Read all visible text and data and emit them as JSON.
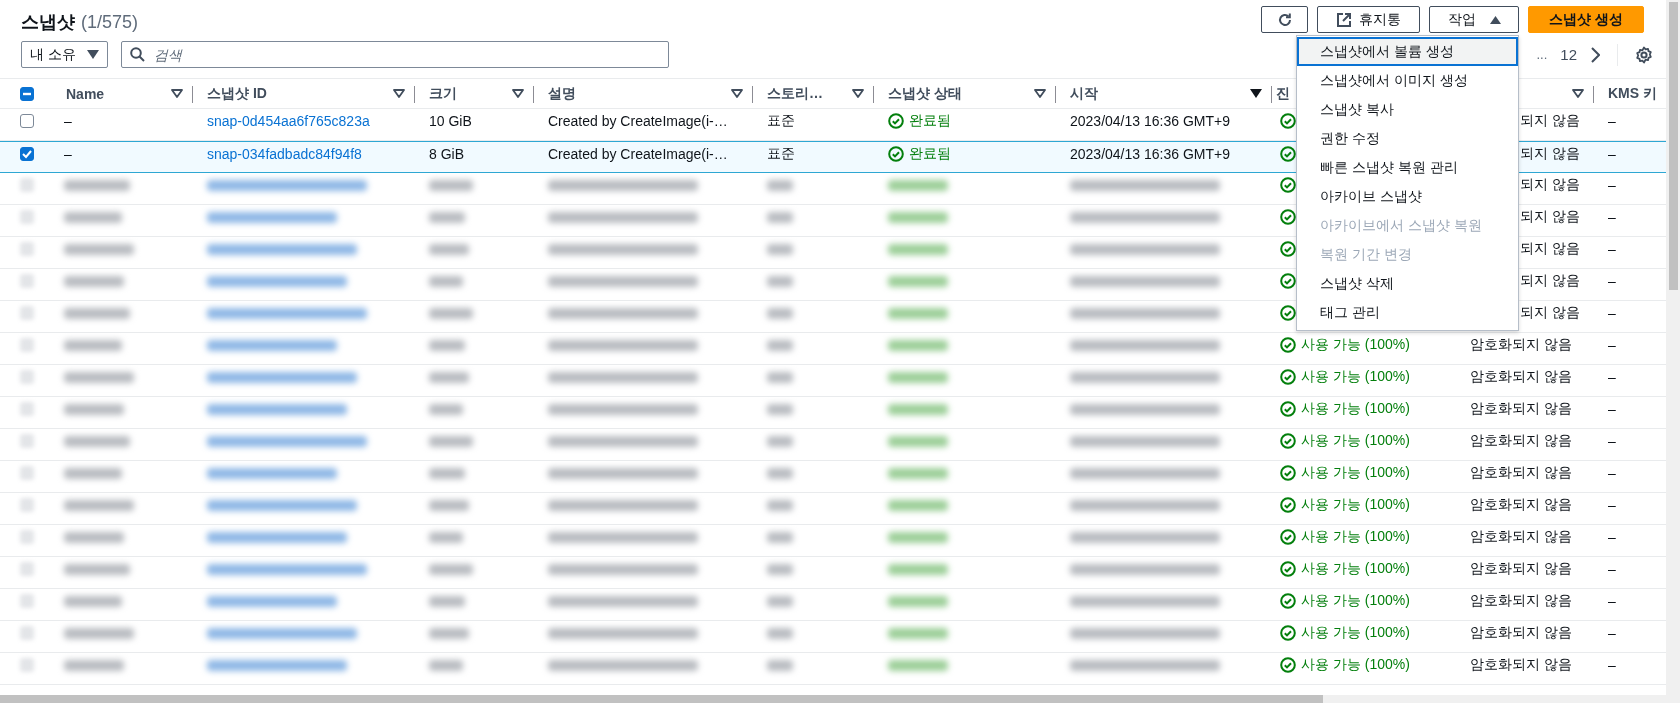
{
  "header": {
    "title": "스냅샷",
    "count": "(1/575)"
  },
  "buttons": [
    {
      "kind": "refresh"
    },
    {
      "kind": "external",
      "label": "휴지통"
    },
    {
      "kind": "dropdown",
      "label": "작업",
      "expanded": true
    },
    {
      "kind": "primary",
      "label": "스냅샷 생성"
    }
  ],
  "actions_menu": [
    {
      "label": "스냅샷에서 볼륨 생성",
      "focused": true,
      "disabled": false
    },
    {
      "label": "스냅샷에서 이미지 생성",
      "focused": false,
      "disabled": false
    },
    {
      "label": "스냅샷 복사",
      "focused": false,
      "disabled": false
    },
    {
      "label": "권한 수정",
      "focused": false,
      "disabled": false
    },
    {
      "label": "빠른 스냅샷 복원 관리",
      "focused": false,
      "disabled": false
    },
    {
      "label": "아카이브 스냅샷",
      "focused": false,
      "disabled": false
    },
    {
      "label": "아카이브에서 스냅샷 복원",
      "focused": false,
      "disabled": true
    },
    {
      "label": "복원 기간 변경",
      "focused": false,
      "disabled": true
    },
    {
      "label": "스냅샷 삭제",
      "focused": false,
      "disabled": false
    },
    {
      "label": "태그 관리",
      "focused": false,
      "disabled": false
    }
  ],
  "filter": {
    "value": "내 소유"
  },
  "search": {
    "placeholder": "검색"
  },
  "pagination": {
    "ellipsis": "...",
    "page": "12"
  },
  "table": {
    "select_all": {
      "indeterminate": true
    },
    "columns": [
      {
        "label": "Name",
        "sorted": false
      },
      {
        "label": "스냅샷 ID",
        "sorted": false
      },
      {
        "label": "크기",
        "sorted": false
      },
      {
        "label": "설명",
        "sorted": false
      },
      {
        "label": "스토리…",
        "sorted": false
      },
      {
        "label": "스냅샷 상태",
        "sorted": false
      },
      {
        "label": "시작",
        "sorted": true
      },
      {
        "label": "진"
      },
      {
        "sorted": false
      },
      {
        "label": "KMS 키"
      }
    ],
    "rows": [
      {
        "blurred": false,
        "selected": false,
        "behind_menu": true,
        "name": "–",
        "id": "snap-0d454aa6f765c823a",
        "size": "10 GiB",
        "description": "Created by CreateImage(i-…",
        "storage": "표준",
        "status": "완료됨",
        "started": "2023/04/13 16:36 GMT+9",
        "encryption": "되지 않음",
        "kms": "–"
      },
      {
        "blurred": false,
        "selected": true,
        "behind_menu": true,
        "name": "–",
        "id": "snap-034fadbadc84f94f8",
        "size": "8 GiB",
        "description": "Created by CreateImage(i-…",
        "storage": "표준",
        "status": "완료됨",
        "started": "2023/04/13 16:36 GMT+9",
        "encryption": "되지 않음",
        "kms": "–"
      },
      {
        "blurred": true,
        "behind_menu": true,
        "encryption": "되지 않음",
        "kms": "–"
      },
      {
        "blurred": true,
        "behind_menu": true,
        "encryption": "되지 않음",
        "kms": "–"
      },
      {
        "blurred": true,
        "behind_menu": true,
        "encryption": "되지 않음",
        "kms": "–"
      },
      {
        "blurred": true,
        "behind_menu": true,
        "encryption": "되지 않음",
        "kms": "–"
      },
      {
        "blurred": true,
        "behind_menu": true,
        "encryption": "되지 않음",
        "kms": "–"
      },
      {
        "blurred": true,
        "behind_menu": false,
        "progress": "사용 가능 (100%)",
        "encryption": "암호화되지 않음",
        "kms": "–"
      },
      {
        "blurred": true,
        "behind_menu": false,
        "progress": "사용 가능 (100%)",
        "encryption": "암호화되지 않음",
        "kms": "–"
      },
      {
        "blurred": true,
        "behind_menu": false,
        "progress": "사용 가능 (100%)",
        "encryption": "암호화되지 않음",
        "kms": "–"
      },
      {
        "blurred": true,
        "behind_menu": false,
        "progress": "사용 가능 (100%)",
        "encryption": "암호화되지 않음",
        "kms": "–"
      },
      {
        "blurred": true,
        "behind_menu": false,
        "progress": "사용 가능 (100%)",
        "encryption": "암호화되지 않음",
        "kms": "–"
      },
      {
        "blurred": true,
        "behind_menu": false,
        "progress": "사용 가능 (100%)",
        "encryption": "암호화되지 않음",
        "kms": "–"
      },
      {
        "blurred": true,
        "behind_menu": false,
        "progress": "사용 가능 (100%)",
        "encryption": "암호화되지 않음",
        "kms": "–"
      },
      {
        "blurred": true,
        "behind_menu": false,
        "progress": "사용 가능 (100%)",
        "encryption": "암호화되지 않음",
        "kms": "–"
      },
      {
        "blurred": true,
        "behind_menu": false,
        "progress": "사용 가능 (100%)",
        "encryption": "암호화되지 않음",
        "kms": "–"
      },
      {
        "blurred": true,
        "behind_menu": false,
        "progress": "사용 가능 (100%)",
        "encryption": "암호화되지 않음",
        "kms": "–"
      },
      {
        "blurred": true,
        "behind_menu": false,
        "progress": "사용 가능 (100%)",
        "encryption": "암호화되지 않음",
        "kms": "–"
      }
    ]
  }
}
